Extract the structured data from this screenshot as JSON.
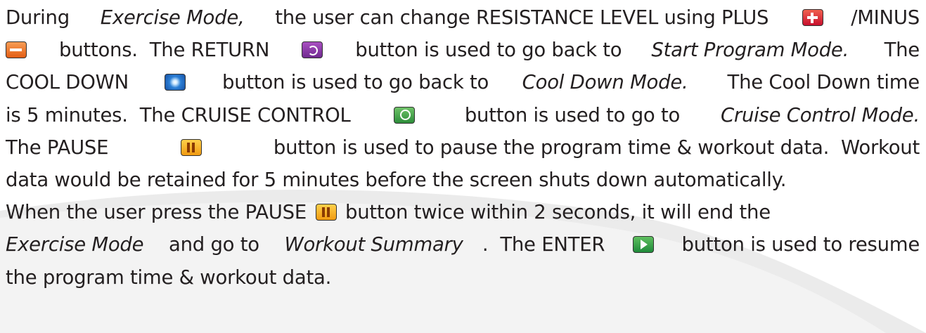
{
  "lines": [
    [
      "During ",
      "Exercise Mode,",
      " the user can change RESISTANCE LEVEL using PLUS ",
      "/MINUS"
    ],
    [
      " buttons.  The RETURN ",
      " button is used to go back to ",
      "Start  Program  Mode.",
      "  The"
    ],
    [
      "COOL DOWN ",
      " button is used to go back to ",
      "Cool Down Mode.",
      "  The Cool Down time"
    ],
    [
      "is 5 minutes.  The CRUISE CONTROL ",
      "  button is used to go to ",
      "Cruise Control Mode."
    ],
    [
      "The PAUSE ",
      " button is used to pause the program time & workout data.  Workout"
    ],
    [
      "data would be retained for 5 minutes before the screen shuts down automatically."
    ],
    [
      "When the user press the PAUSE ",
      " button twice within 2 seconds, it will end the"
    ],
    [
      "Exercise Mode",
      " and go to ",
      "Workout Summary",
      ".  The ENTER ",
      " button is used to resume"
    ],
    [
      "the program time & workout data."
    ]
  ],
  "icons": {
    "plus": "plus-button-icon",
    "minus": "minus-button-icon",
    "return": "return-button-icon",
    "cool_down": "cool-down-button-icon",
    "cruise_control": "cruise-control-button-icon",
    "pause": "pause-button-icon",
    "enter": "enter-button-icon"
  },
  "colors": {
    "text": "#231f20",
    "plus": "#c8102e",
    "minus": "#e35d14",
    "return": "#6f2a8f",
    "cool_down": "#174fa1",
    "cruise_control": "#2d8d3a",
    "pause": "#f09a12",
    "enter": "#1f8a3a",
    "swoosh": "#ebebeb"
  }
}
